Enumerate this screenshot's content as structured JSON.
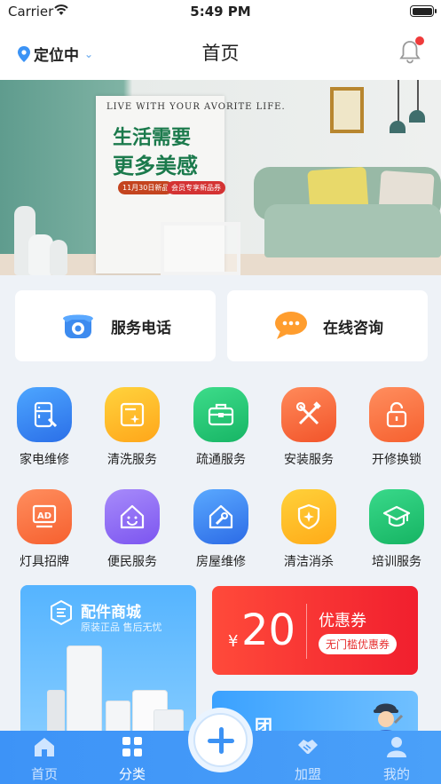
{
  "status_bar": {
    "carrier": "Carrier",
    "time": "5:49 PM"
  },
  "nav": {
    "location": "定位中",
    "title": "首页",
    "notification_badge": true
  },
  "banner": {
    "tagline_en": "LIVE WITH YOUR AVORITE LIFE.",
    "headline_1": "生活需要",
    "headline_2": "更多美感",
    "tag_1": "11月30日新品",
    "tag_2": "会员专享新品券"
  },
  "quick_actions": [
    {
      "label": "服务电话",
      "icon": "phone-icon"
    },
    {
      "label": "在线咨询",
      "icon": "chat-bubble-icon"
    }
  ],
  "services": [
    {
      "label": "家电维修",
      "icon": "appliance-repair-icon",
      "color": "#2b6fe8"
    },
    {
      "label": "清洗服务",
      "icon": "cleaning-icon",
      "color": "#ffa61a"
    },
    {
      "label": "疏通服务",
      "icon": "toolbox-icon",
      "color": "#17b565"
    },
    {
      "label": "安装服务",
      "icon": "wrench-screwdriver-icon",
      "color": "#f2542a"
    },
    {
      "label": "开修换锁",
      "icon": "lock-icon",
      "color": "#f2542a"
    },
    {
      "label": "灯具招牌",
      "icon": "ad-sign-icon",
      "color": "#f6602f"
    },
    {
      "label": "便民服务",
      "icon": "smile-house-icon",
      "color": "#7c55f0"
    },
    {
      "label": "房屋维修",
      "icon": "house-wrench-icon",
      "color": "#2c6be6"
    },
    {
      "label": "清洁消杀",
      "icon": "shield-sparkle-icon",
      "color": "#ffab18"
    },
    {
      "label": "培训服务",
      "icon": "graduation-cap-icon",
      "color": "#16b463"
    }
  ],
  "promo_parts": {
    "title": "配件商城",
    "subtitle": "原装正品 售后无忧"
  },
  "promo_coupon": {
    "currency": "¥",
    "amount": "20",
    "title": "优惠券",
    "tag": "无门槛优惠券"
  },
  "promo_partial": {
    "visible_text": "团"
  },
  "tabbar": [
    {
      "label": "首页",
      "icon": "home-icon",
      "active": false
    },
    {
      "label": "分类",
      "icon": "grid-icon",
      "active": true
    },
    {
      "label": "加盟",
      "icon": "handshake-icon",
      "active": false
    },
    {
      "label": "我的",
      "icon": "user-icon",
      "active": false
    }
  ],
  "colors": {
    "primary": "#3d93f7",
    "coupon_red": "#f11f2e",
    "badge_red": "#ef3b3b"
  }
}
